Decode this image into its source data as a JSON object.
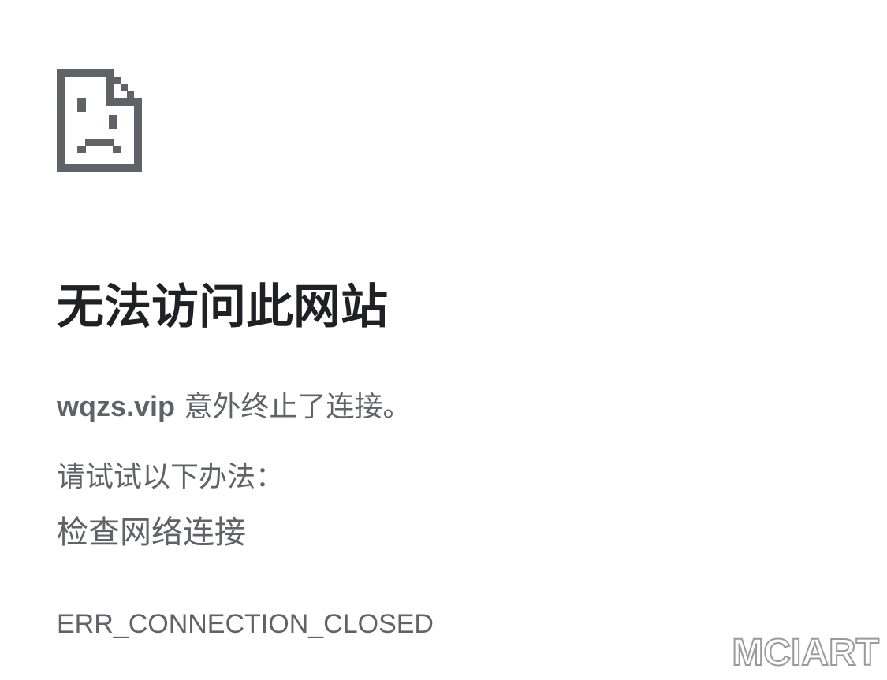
{
  "icon": "sad-page-icon",
  "title": "无法访问此网站",
  "message": {
    "host": "wqzs.vip",
    "text": " 意外终止了连接。"
  },
  "suggestions": {
    "label": "请试试以下办法：",
    "items": [
      "检查网络连接"
    ]
  },
  "error_code": "ERR_CONNECTION_CLOSED",
  "watermark": "MCIART",
  "colors": {
    "icon": "#5f6368",
    "title": "#202124",
    "body_text": "#5f6368",
    "background": "#ffffff"
  }
}
